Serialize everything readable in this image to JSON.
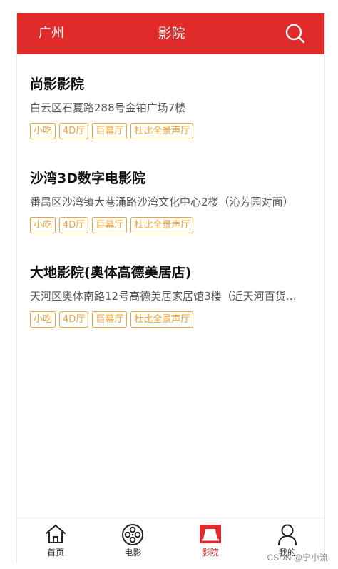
{
  "header": {
    "city": "广州",
    "title": "影院",
    "search_icon": "search-icon"
  },
  "cinemas": [
    {
      "name": "尚影影院",
      "address": "白云区石夏路288号金铂广场7楼",
      "tags": [
        "小吃",
        "4D厅",
        "巨幕厅",
        "杜比全景声厅"
      ]
    },
    {
      "name": "沙湾3D数字电影院",
      "address": "番禺区沙湾镇大巷涌路沙湾文化中心2楼（沁芳园对面）",
      "tags": [
        "小吃",
        "4D厅",
        "巨幕厅",
        "杜比全景声厅"
      ]
    },
    {
      "name": "大地影院(奥体高德美居店)",
      "address": "天河区奥体南路12号高德美居家居馆3楼（近天河百货…",
      "tags": [
        "小吃",
        "4D厅",
        "巨幕厅",
        "杜比全景声厅"
      ]
    }
  ],
  "tabbar": {
    "items": [
      {
        "label": "首页",
        "icon": "home-icon"
      },
      {
        "label": "电影",
        "icon": "film-reel-icon"
      },
      {
        "label": "影院",
        "icon": "cinema-screen-icon",
        "active": true
      },
      {
        "label": "我的",
        "icon": "user-icon"
      }
    ]
  },
  "watermark": "CSDN @宁小流",
  "colors": {
    "brand": "#e02b2a",
    "tag": "#f0a235"
  }
}
